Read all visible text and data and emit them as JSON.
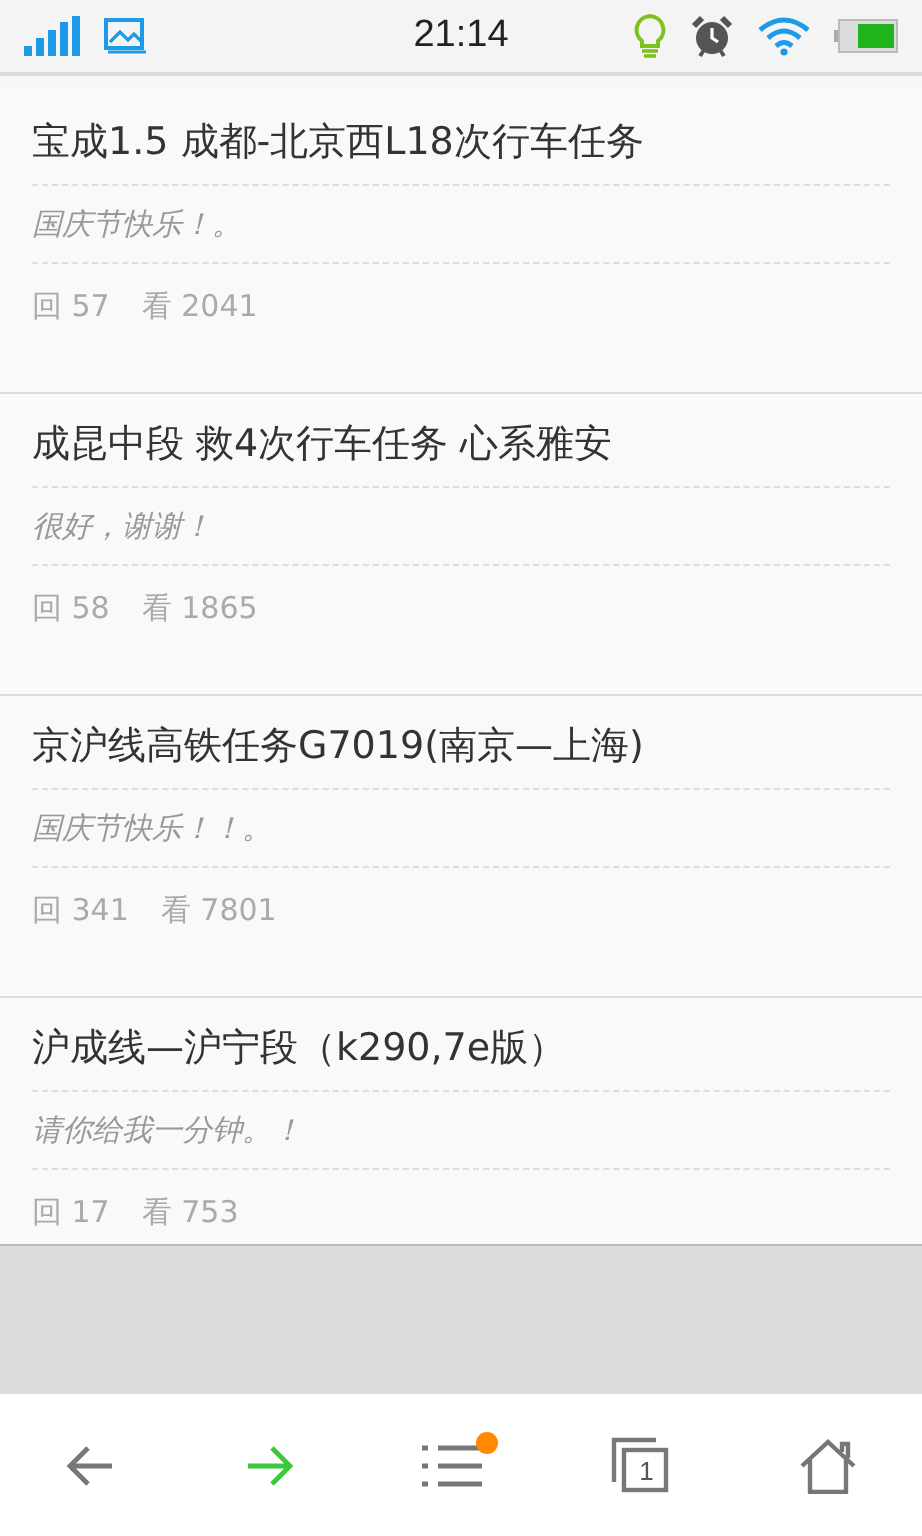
{
  "status_bar": {
    "time": "21:14"
  },
  "posts": [
    {
      "title": "宝成1.5 成都-北京西L18次行车任务",
      "last_reply": "国庆节快乐！。",
      "replies": "回 57",
      "views": "看 2041"
    },
    {
      "title": "成昆中段 救4次行车任务 心系雅安",
      "last_reply": "很好，谢谢！",
      "replies": "回 58",
      "views": "看 1865"
    },
    {
      "title": "京沪线高铁任务G7019(南京—上海)",
      "last_reply": "国庆节快乐！！。",
      "replies": "回 341",
      "views": "看 7801"
    },
    {
      "title": "沪成线—沪宁段（k290,7e版）",
      "last_reply": "请你给我一分钟。！",
      "replies": "回 17",
      "views": "看 753"
    }
  ],
  "bottom_nav": {
    "menu_has_new": true,
    "tab_count": "1"
  }
}
